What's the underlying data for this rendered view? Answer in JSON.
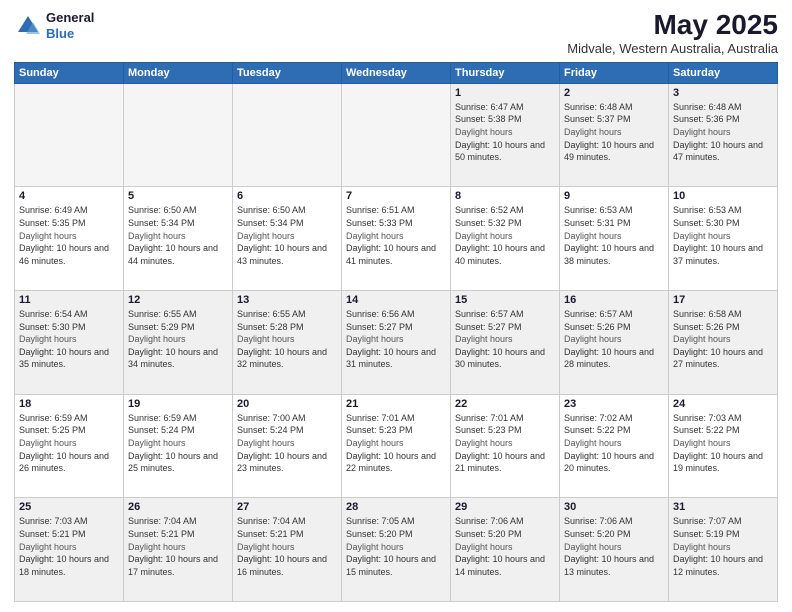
{
  "header": {
    "logo_line1": "General",
    "logo_line2": "Blue",
    "month": "May 2025",
    "location": "Midvale, Western Australia, Australia"
  },
  "weekdays": [
    "Sunday",
    "Monday",
    "Tuesday",
    "Wednesday",
    "Thursday",
    "Friday",
    "Saturday"
  ],
  "weeks": [
    [
      {
        "day": "",
        "empty": true
      },
      {
        "day": "",
        "empty": true
      },
      {
        "day": "",
        "empty": true
      },
      {
        "day": "",
        "empty": true
      },
      {
        "day": "1",
        "sunrise": "6:47 AM",
        "sunset": "5:38 PM",
        "daylight": "10 hours and 50 minutes."
      },
      {
        "day": "2",
        "sunrise": "6:48 AM",
        "sunset": "5:37 PM",
        "daylight": "10 hours and 49 minutes."
      },
      {
        "day": "3",
        "sunrise": "6:48 AM",
        "sunset": "5:36 PM",
        "daylight": "10 hours and 47 minutes."
      }
    ],
    [
      {
        "day": "4",
        "sunrise": "6:49 AM",
        "sunset": "5:35 PM",
        "daylight": "10 hours and 46 minutes."
      },
      {
        "day": "5",
        "sunrise": "6:50 AM",
        "sunset": "5:34 PM",
        "daylight": "10 hours and 44 minutes."
      },
      {
        "day": "6",
        "sunrise": "6:50 AM",
        "sunset": "5:34 PM",
        "daylight": "10 hours and 43 minutes."
      },
      {
        "day": "7",
        "sunrise": "6:51 AM",
        "sunset": "5:33 PM",
        "daylight": "10 hours and 41 minutes."
      },
      {
        "day": "8",
        "sunrise": "6:52 AM",
        "sunset": "5:32 PM",
        "daylight": "10 hours and 40 minutes."
      },
      {
        "day": "9",
        "sunrise": "6:53 AM",
        "sunset": "5:31 PM",
        "daylight": "10 hours and 38 minutes."
      },
      {
        "day": "10",
        "sunrise": "6:53 AM",
        "sunset": "5:30 PM",
        "daylight": "10 hours and 37 minutes."
      }
    ],
    [
      {
        "day": "11",
        "sunrise": "6:54 AM",
        "sunset": "5:30 PM",
        "daylight": "10 hours and 35 minutes."
      },
      {
        "day": "12",
        "sunrise": "6:55 AM",
        "sunset": "5:29 PM",
        "daylight": "10 hours and 34 minutes."
      },
      {
        "day": "13",
        "sunrise": "6:55 AM",
        "sunset": "5:28 PM",
        "daylight": "10 hours and 32 minutes."
      },
      {
        "day": "14",
        "sunrise": "6:56 AM",
        "sunset": "5:27 PM",
        "daylight": "10 hours and 31 minutes."
      },
      {
        "day": "15",
        "sunrise": "6:57 AM",
        "sunset": "5:27 PM",
        "daylight": "10 hours and 30 minutes."
      },
      {
        "day": "16",
        "sunrise": "6:57 AM",
        "sunset": "5:26 PM",
        "daylight": "10 hours and 28 minutes."
      },
      {
        "day": "17",
        "sunrise": "6:58 AM",
        "sunset": "5:26 PM",
        "daylight": "10 hours and 27 minutes."
      }
    ],
    [
      {
        "day": "18",
        "sunrise": "6:59 AM",
        "sunset": "5:25 PM",
        "daylight": "10 hours and 26 minutes."
      },
      {
        "day": "19",
        "sunrise": "6:59 AM",
        "sunset": "5:24 PM",
        "daylight": "10 hours and 25 minutes."
      },
      {
        "day": "20",
        "sunrise": "7:00 AM",
        "sunset": "5:24 PM",
        "daylight": "10 hours and 23 minutes."
      },
      {
        "day": "21",
        "sunrise": "7:01 AM",
        "sunset": "5:23 PM",
        "daylight": "10 hours and 22 minutes."
      },
      {
        "day": "22",
        "sunrise": "7:01 AM",
        "sunset": "5:23 PM",
        "daylight": "10 hours and 21 minutes."
      },
      {
        "day": "23",
        "sunrise": "7:02 AM",
        "sunset": "5:22 PM",
        "daylight": "10 hours and 20 minutes."
      },
      {
        "day": "24",
        "sunrise": "7:03 AM",
        "sunset": "5:22 PM",
        "daylight": "10 hours and 19 minutes."
      }
    ],
    [
      {
        "day": "25",
        "sunrise": "7:03 AM",
        "sunset": "5:21 PM",
        "daylight": "10 hours and 18 minutes."
      },
      {
        "day": "26",
        "sunrise": "7:04 AM",
        "sunset": "5:21 PM",
        "daylight": "10 hours and 17 minutes."
      },
      {
        "day": "27",
        "sunrise": "7:04 AM",
        "sunset": "5:21 PM",
        "daylight": "10 hours and 16 minutes."
      },
      {
        "day": "28",
        "sunrise": "7:05 AM",
        "sunset": "5:20 PM",
        "daylight": "10 hours and 15 minutes."
      },
      {
        "day": "29",
        "sunrise": "7:06 AM",
        "sunset": "5:20 PM",
        "daylight": "10 hours and 14 minutes."
      },
      {
        "day": "30",
        "sunrise": "7:06 AM",
        "sunset": "5:20 PM",
        "daylight": "10 hours and 13 minutes."
      },
      {
        "day": "31",
        "sunrise": "7:07 AM",
        "sunset": "5:19 PM",
        "daylight": "10 hours and 12 minutes."
      }
    ]
  ],
  "labels": {
    "sunrise_prefix": "Sunrise: ",
    "sunset_prefix": "Sunset: ",
    "daylight_label": "Daylight hours",
    "daylight_prefix": "Daylight: "
  }
}
